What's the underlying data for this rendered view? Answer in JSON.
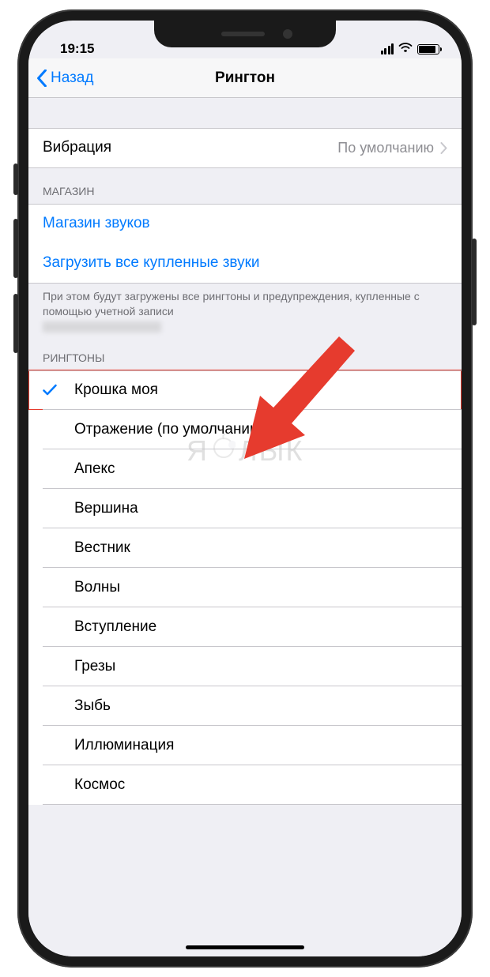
{
  "status": {
    "time": "19:15"
  },
  "nav": {
    "back": "Назад",
    "title": "Рингтон"
  },
  "vibration": {
    "label": "Вибрация",
    "value": "По умолчанию"
  },
  "store": {
    "header": "МАГАЗИН",
    "soundStore": "Магазин звуков",
    "downloadAll": "Загрузить все купленные звуки",
    "footer": "При этом будут загружены все рингтоны и предупреждения, купленные с помощью учетной записи"
  },
  "ringtones": {
    "header": "РИНГТОНЫ",
    "selectedIndex": 0,
    "items": [
      "Крошка моя",
      "Отражение (по умолчанию)",
      "Апекс",
      "Вершина",
      "Вестник",
      "Волны",
      "Вступление",
      "Грезы",
      "Зыбь",
      "Иллюминация",
      "Космос"
    ]
  },
  "watermark": {
    "left": "Я",
    "right": "ЛЫК"
  }
}
